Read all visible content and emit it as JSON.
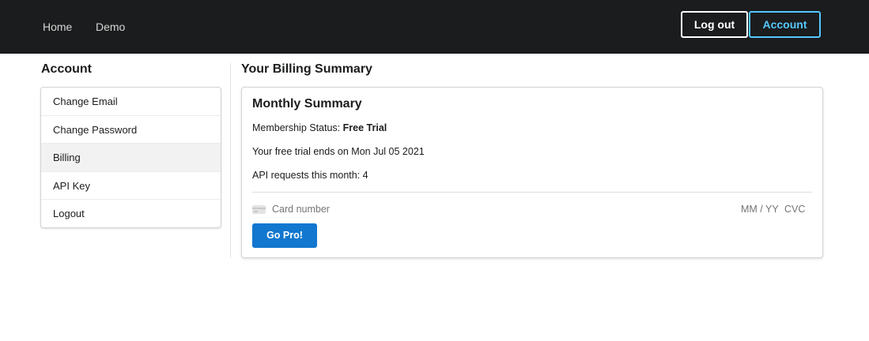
{
  "topnav": {
    "links": [
      {
        "label": "Home"
      },
      {
        "label": "Demo"
      }
    ],
    "logout_label": "Log out",
    "account_label": "Account",
    "account_accent": "#54c8ff",
    "background": "#1b1c1d"
  },
  "sidebar": {
    "heading": "Account",
    "items": [
      {
        "label": "Change Email"
      },
      {
        "label": "Change Password"
      },
      {
        "label": "Billing",
        "active": true
      },
      {
        "label": "API Key"
      },
      {
        "label": "Logout"
      }
    ]
  },
  "main": {
    "heading": "Your Billing Summary",
    "card": {
      "title": "Monthly Summary",
      "membership_label": "Membership Status:",
      "membership_value": "Free Trial",
      "trial_text": "Your free trial ends on Mon Jul 05 2021",
      "api_label": "API requests this month:",
      "api_value": "4",
      "payment": {
        "card_icon": "credit-card-icon",
        "card_number_placeholder": "Card number",
        "expiry_placeholder": "MM / YY",
        "cvc_placeholder": "CVC"
      },
      "gopro_label": "Go Pro!",
      "gopro_color": "#1177cf"
    }
  }
}
